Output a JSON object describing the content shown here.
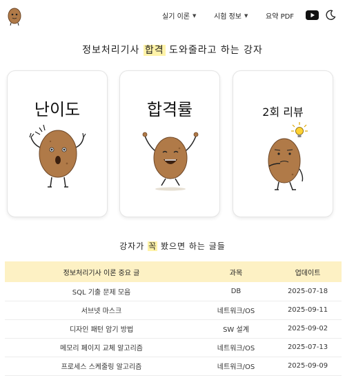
{
  "nav": {
    "items": [
      {
        "label": "실기 이론",
        "icon": "chevron-down-icon"
      },
      {
        "label": "시험 정보",
        "icon": "chevron-down-icon"
      },
      {
        "label": "요약 PDF"
      }
    ],
    "youtube_icon": "youtube-icon",
    "theme_icon": "moon-icon"
  },
  "headline": {
    "before": "정보처리기사 ",
    "highlight": "합격",
    "after": " 도와줄라고 하는 강자"
  },
  "cards": [
    {
      "title": "난이도",
      "illustration": "surprised-potato"
    },
    {
      "title": "합격률",
      "illustration": "cheering-potato"
    },
    {
      "title": "2회 리뷰",
      "illustration": "thinking-potato-with-bulb"
    }
  ],
  "section": {
    "before": "강자가 ",
    "highlight": "꼭",
    "after": " 봤으면 하는 글들"
  },
  "table": {
    "headers": [
      "정보처리기사 이론 중요 글",
      "과목",
      "업데이트"
    ],
    "rows": [
      [
        "SQL 기출 문제 모음",
        "DB",
        "2025-07-18"
      ],
      [
        "서브넷 마스크",
        "네트워크/OS",
        "2025-09-11"
      ],
      [
        "디자인 패턴 암기 방법",
        "SW 설계",
        "2025-09-02"
      ],
      [
        "메모리 페이지 교체 알고리즘",
        "네트워크/OS",
        "2025-07-13"
      ],
      [
        "프로세스 스케줄링 알고리즘",
        "네트워크/OS",
        "2025-09-09"
      ]
    ]
  },
  "colors": {
    "highlight": "#fff3a8",
    "table_header": "#fdf1c4",
    "potato": "#b07a48",
    "potato_dark": "#8a5a30"
  }
}
